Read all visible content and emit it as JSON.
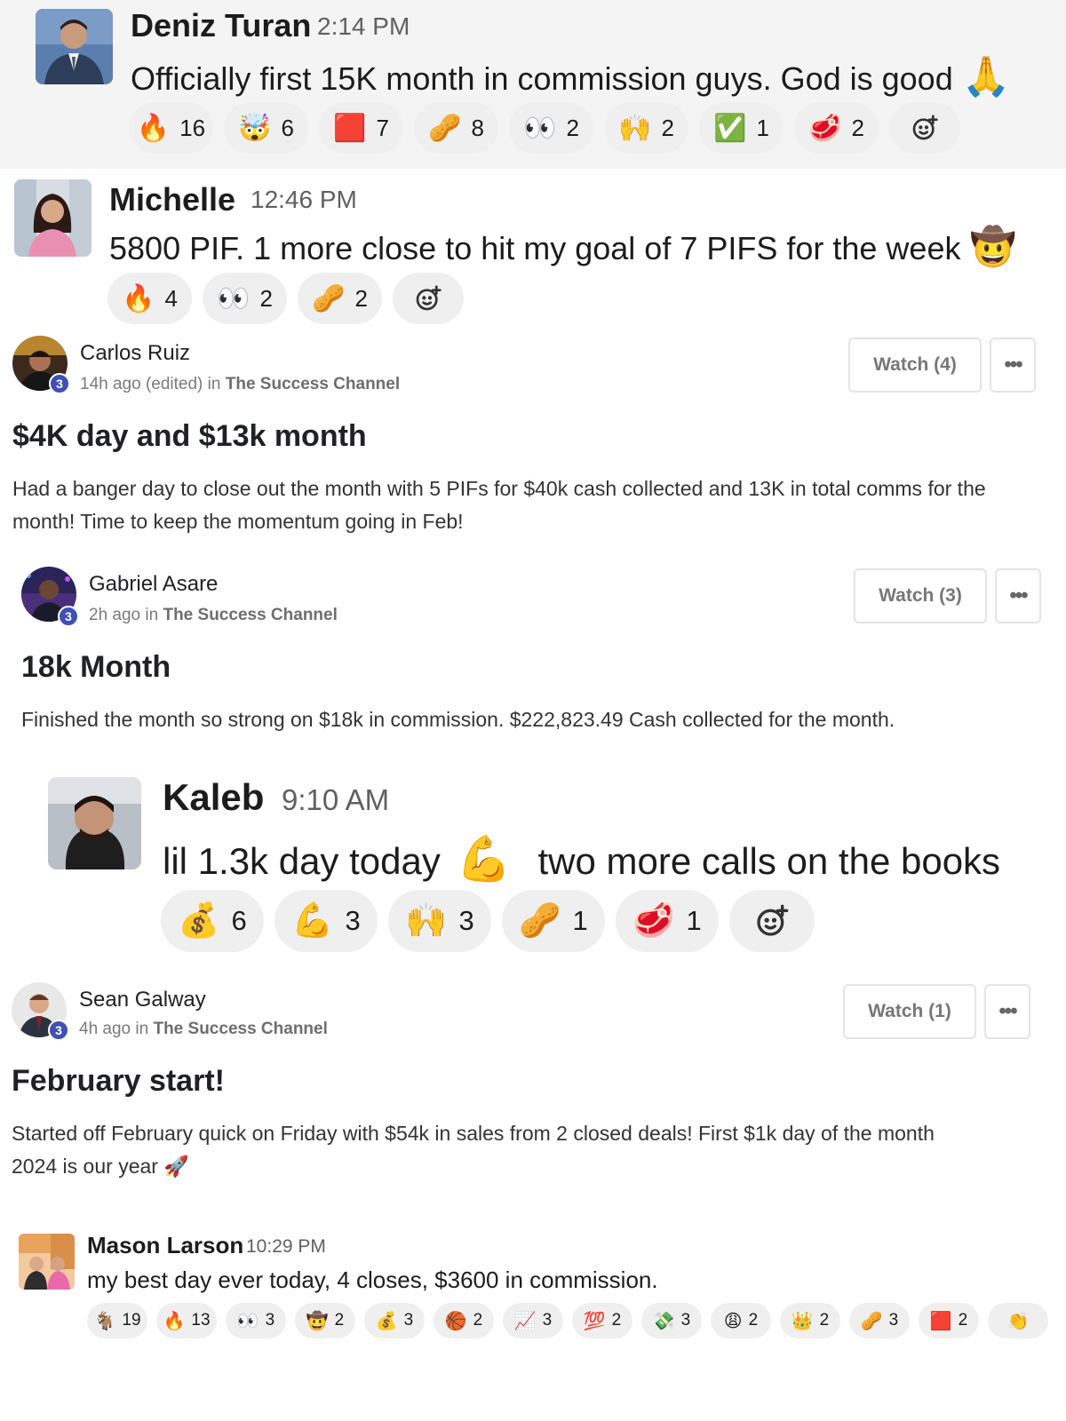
{
  "messages": [
    {
      "name": "Deniz Turan",
      "time": "2:14 PM",
      "text": "Officially first 15K month in commission guys. God is good",
      "trailing_emoji": "🙏",
      "reactions": [
        {
          "emoji": "🔥",
          "count": "16"
        },
        {
          "emoji": "🤯",
          "count": "6"
        },
        {
          "emoji": "🟥",
          "count": "7"
        },
        {
          "emoji": "🥜",
          "count": "8"
        },
        {
          "emoji": "👀",
          "count": "2"
        },
        {
          "emoji": "🙌",
          "count": "2"
        },
        {
          "emoji": "✅",
          "count": "1"
        },
        {
          "emoji": "🥩",
          "count": "2"
        }
      ]
    },
    {
      "name": "Michelle",
      "time": "12:46 PM",
      "text": "5800 PIF. 1 more close to hit my goal of 7 PIFS for the week",
      "trailing_emoji": "🤠",
      "reactions": [
        {
          "emoji": "🔥",
          "count": "4"
        },
        {
          "emoji": "👀",
          "count": "2"
        },
        {
          "emoji": "🥜",
          "count": "2"
        }
      ]
    },
    {
      "name": "Kaleb",
      "time": "9:10 AM",
      "text_before": "lil 1.3k day today",
      "inline_emoji": "💪",
      "text_after": "two more calls on the books",
      "reactions": [
        {
          "emoji": "💰",
          "count": "6"
        },
        {
          "emoji": "💪",
          "count": "3"
        },
        {
          "emoji": "🙌",
          "count": "3"
        },
        {
          "emoji": "🥜",
          "count": "1"
        },
        {
          "emoji": "🥩",
          "count": "1"
        }
      ]
    },
    {
      "name": "Mason Larson",
      "time": "10:29 PM",
      "text": "my best day ever today, 4 closes, $3600 in commission.",
      "reactions": [
        {
          "emoji": "🐐",
          "count": "19"
        },
        {
          "emoji": "🔥",
          "count": "13"
        },
        {
          "emoji": "👀",
          "count": "3"
        },
        {
          "emoji": "🤠",
          "count": "2"
        },
        {
          "emoji": "💰",
          "count": "3"
        },
        {
          "emoji": "🏀",
          "count": "2"
        },
        {
          "emoji": "📈",
          "count": "3"
        },
        {
          "emoji": "💯",
          "count": "2"
        },
        {
          "emoji": "💸",
          "count": "3"
        },
        {
          "emoji": "😩",
          "count": "2"
        },
        {
          "emoji": "👑",
          "count": "2"
        },
        {
          "emoji": "🥜",
          "count": "3"
        },
        {
          "emoji": "🟥",
          "count": "2"
        },
        {
          "emoji": "👏",
          "count": ""
        }
      ]
    }
  ],
  "posts": [
    {
      "name": "Carlos Ruiz",
      "level": "3",
      "meta_prefix": "14h ago (edited) in",
      "channel": "The Success Channel",
      "watch_label": "Watch (4)",
      "more_label": "•••",
      "title": "$4K day and $13k month",
      "body": "Had a banger day to close out the month with 5 PIFs for $40k cash collected and 13K in total comms for the month! Time to keep the momentum going in Feb!"
    },
    {
      "name": "Gabriel Asare",
      "level": "3",
      "meta_prefix": "2h ago in",
      "channel": "The Success Channel",
      "watch_label": "Watch (3)",
      "more_label": "•••",
      "title": "18k Month",
      "body": "Finished the month so strong on $18k in commission. $222,823.49 Cash collected for the month."
    },
    {
      "name": "Sean Galway",
      "level": "3",
      "meta_prefix": "4h ago in",
      "channel": "The Success Channel",
      "watch_label": "Watch (1)",
      "more_label": "•••",
      "title": "February start!",
      "body_line1": "Started off February quick on Friday with $54k in sales from 2 closed deals! First $1k day of the month",
      "body_line2": "2024 is our year",
      "body_emoji": "🚀"
    }
  ],
  "icons": {
    "add_reaction": "add-reaction-icon",
    "accent_badge": "#3f51b5",
    "pill_bg": "#efeff0",
    "highlight_bg": "#f4f4f4"
  }
}
